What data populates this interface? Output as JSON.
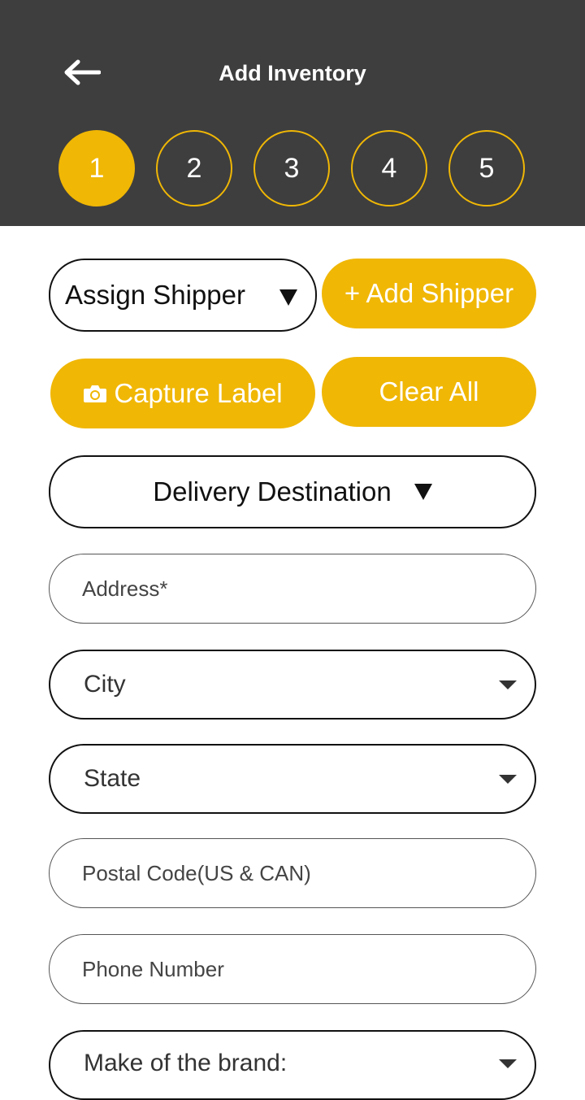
{
  "header": {
    "title": "Add Inventory",
    "steps": [
      "1",
      "2",
      "3",
      "4",
      "5"
    ],
    "active_step": "1"
  },
  "actions": {
    "assign_shipper": "Assign Shipper",
    "add_shipper": "+ Add Shipper",
    "capture_label": "Capture Label",
    "clear_all": "Clear All",
    "delivery_destination": "Delivery Destination"
  },
  "form": {
    "address": "Address*",
    "city": "City",
    "state": "State",
    "postal_code": "Postal Code(US & CAN)",
    "phone_number": "Phone Number",
    "make_of_brand": "Make of the brand:"
  },
  "icons": {
    "back": "arrow-left-icon",
    "camera": "camera-icon",
    "dropdown": "triangle-down-icon"
  },
  "colors": {
    "header_bg": "#3e3e3e",
    "accent": "#f0b705",
    "text_dark": "#111111"
  }
}
